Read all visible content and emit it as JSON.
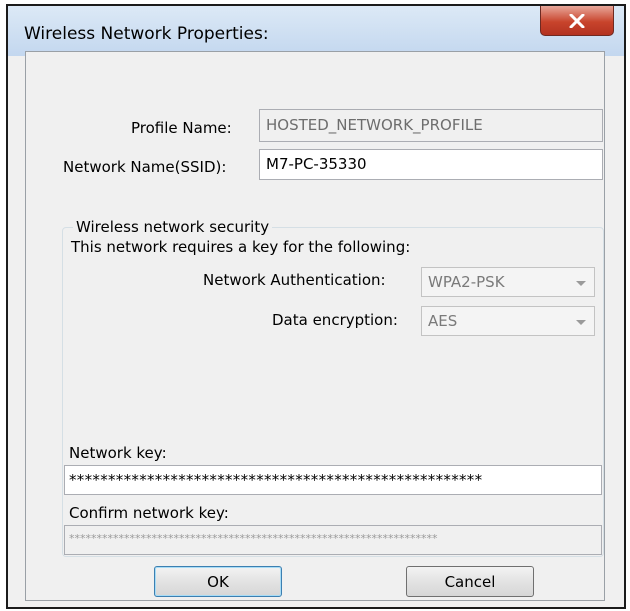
{
  "window": {
    "title": "Wireless Network Properties:",
    "close_glyph": "x"
  },
  "profile": {
    "label": "Profile Name:",
    "value": "HOSTED_NETWORK_PROFILE"
  },
  "ssid": {
    "label": "Network Name(SSID):",
    "value": "M7-PC-35330"
  },
  "security": {
    "legend": "Wireless network security",
    "description": "This network requires a key for the following:",
    "authentication": {
      "label": "Network Authentication:",
      "value": "WPA2-PSK"
    },
    "encryption": {
      "label": "Data encryption:",
      "value": "AES"
    },
    "network_key": {
      "label": "Network key:",
      "value": "*****************************************************"
    },
    "confirm_key": {
      "label": "Confirm network key:",
      "value": "*******************************************************************"
    }
  },
  "buttons": {
    "ok": "OK",
    "cancel": "Cancel"
  },
  "colors": {
    "title_bar": "#c3d7ef",
    "close_button": "#c8442c",
    "dialog_background": "#f0f0f0"
  }
}
